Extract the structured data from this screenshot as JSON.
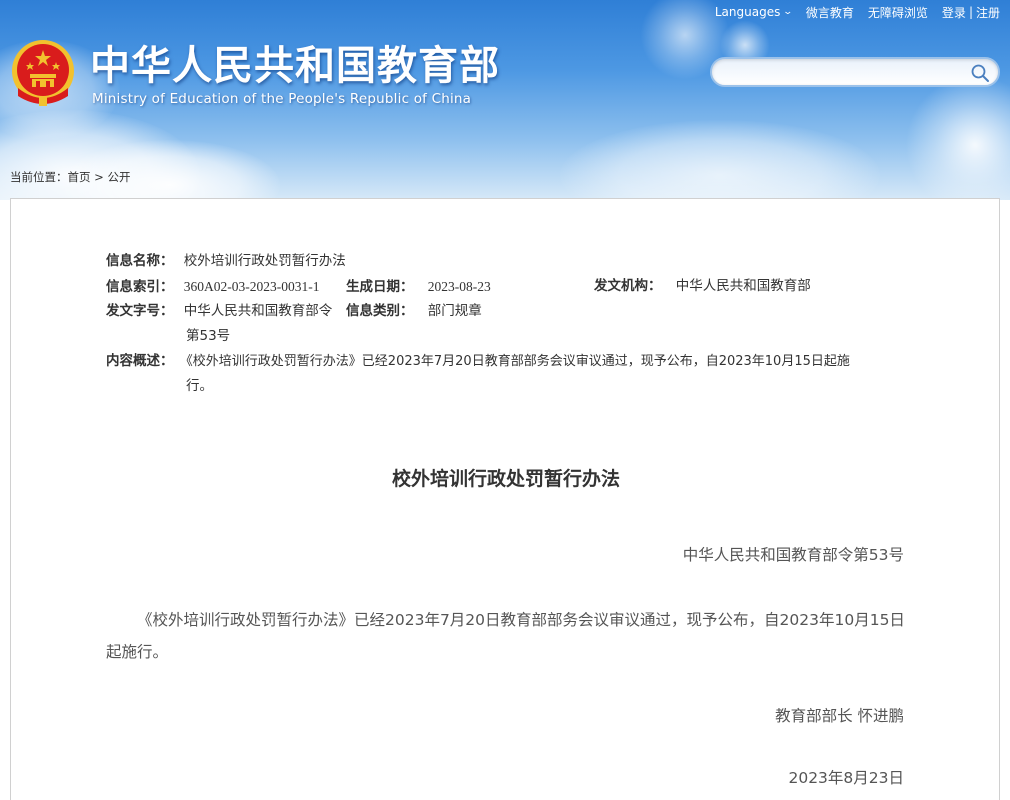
{
  "header": {
    "site_title": "中华人民共和国教育部",
    "site_subtitle": "Ministry of Education of the People's Republic of China",
    "top_links": {
      "languages": "Languages",
      "weibo_edu": "微言教育",
      "accessible": "无障碍浏览",
      "login": "登录",
      "separator": "|",
      "register": "注册"
    },
    "search": {
      "placeholder": "",
      "value": ""
    }
  },
  "breadcrumb": {
    "prefix": "当前位置：",
    "home": "首页",
    "sep": " > ",
    "current": "公开"
  },
  "meta": {
    "info_name_label": "信息名称：",
    "info_name": "校外培训行政处罚暂行办法",
    "index_label": "信息索引：",
    "index": "360A02-03-2023-0031-1",
    "gen_date_label": "生成日期：",
    "gen_date": "2023-08-23",
    "issuer_label": "发文机构：",
    "issuer": "中华人民共和国教育部",
    "doc_no_label": "发文字号：",
    "doc_no_line1": "中华人民共和国教育部令",
    "doc_no_line2": "第53号",
    "category_label": "信息类别：",
    "category": "部门规章",
    "summary_label": "内容概述：",
    "summary_line1": "《校外培训行政处罚暂行办法》已经2023年7月20日教育部部务会议审议通过，现予公布，自2023年10月15日起施",
    "summary_line2": "行。"
  },
  "document": {
    "title": "校外培训行政处罚暂行办法",
    "order_no": "中华人民共和国教育部令第53号",
    "paragraph": "《校外培训行政处罚暂行办法》已经2023年7月20日教育部部务会议审议通过，现予公布，自2023年10月15日起施行。",
    "signer": "教育部部长 怀进鹏",
    "date": "2023年8月23日"
  },
  "colors": {
    "sky_top": "#2f7fd6",
    "emblem_red": "#d91c1c",
    "emblem_gold": "#f2c12e"
  }
}
